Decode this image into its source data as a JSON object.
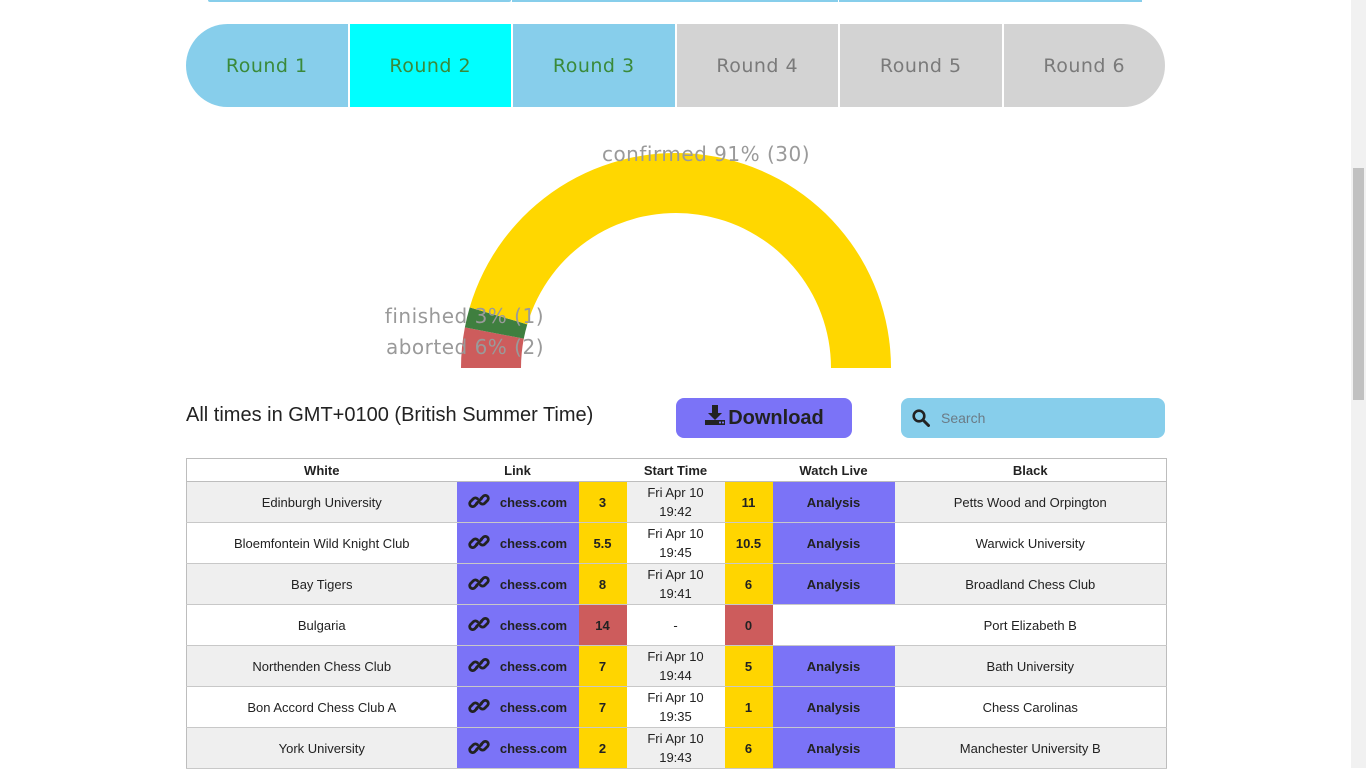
{
  "rounds": [
    {
      "label": "Round 1",
      "state": "done"
    },
    {
      "label": "Round 2",
      "state": "active"
    },
    {
      "label": "Round 3",
      "state": "done"
    },
    {
      "label": "Round 4",
      "state": "future"
    },
    {
      "label": "Round 5",
      "state": "future"
    },
    {
      "label": "Round 6",
      "state": "future"
    }
  ],
  "gauge": {
    "segments": [
      {
        "name": "aborted",
        "label": "aborted 6% (2)",
        "fraction": 0.0606,
        "color": "#cd5c5c"
      },
      {
        "name": "finished",
        "label": "finished 3% (1)",
        "fraction": 0.0303,
        "color": "#3f7f3f"
      },
      {
        "name": "confirmed",
        "label": "confirmed 91% (30)",
        "fraction": 0.9091,
        "color": "#ffd700"
      }
    ]
  },
  "timezone_note": "All times in GMT+0100 (British Summer Time)",
  "download_label": "Download",
  "search": {
    "placeholder": "Search",
    "value": ""
  },
  "colors": {
    "accent": "#7b73f7",
    "search_bg": "#87ceeb",
    "score_yellow": "#ffd500",
    "score_red": "#cd5c5c"
  },
  "table": {
    "headers": {
      "white": "White",
      "link": "Link",
      "start_time": "Start Time",
      "watch_live": "Watch Live",
      "black": "Black"
    },
    "link_text": "chess.com",
    "watch_text": "Analysis",
    "rows": [
      {
        "white": "Edinburgh University",
        "white_score": "3",
        "white_color": "y",
        "date": "Fri Apr 10",
        "time": "19:42",
        "black_score": "11",
        "black_color": "y",
        "watch": true,
        "black": "Petts Wood and Orpington"
      },
      {
        "white": "Bloemfontein Wild Knight Club",
        "white_score": "5.5",
        "white_color": "y",
        "date": "Fri Apr 10",
        "time": "19:45",
        "black_score": "10.5",
        "black_color": "y",
        "watch": true,
        "black": "Warwick University"
      },
      {
        "white": "Bay Tigers",
        "white_score": "8",
        "white_color": "y",
        "date": "Fri Apr 10",
        "time": "19:41",
        "black_score": "6",
        "black_color": "y",
        "watch": true,
        "black": "Broadland Chess Club"
      },
      {
        "white": "Bulgaria",
        "white_score": "14",
        "white_color": "r",
        "date": "-",
        "time": "",
        "black_score": "0",
        "black_color": "r",
        "watch": false,
        "black": "Port Elizabeth B"
      },
      {
        "white": "Northenden Chess Club",
        "white_score": "7",
        "white_color": "y",
        "date": "Fri Apr 10",
        "time": "19:44",
        "black_score": "5",
        "black_color": "y",
        "watch": true,
        "black": "Bath University"
      },
      {
        "white": "Bon Accord Chess Club A",
        "white_score": "7",
        "white_color": "y",
        "date": "Fri Apr 10",
        "time": "19:35",
        "black_score": "1",
        "black_color": "y",
        "watch": true,
        "black": "Chess Carolinas"
      },
      {
        "white": "York University",
        "white_score": "2",
        "white_color": "y",
        "date": "Fri Apr 10",
        "time": "19:43",
        "black_score": "6",
        "black_color": "y",
        "watch": true,
        "black": "Manchester University B"
      }
    ]
  }
}
